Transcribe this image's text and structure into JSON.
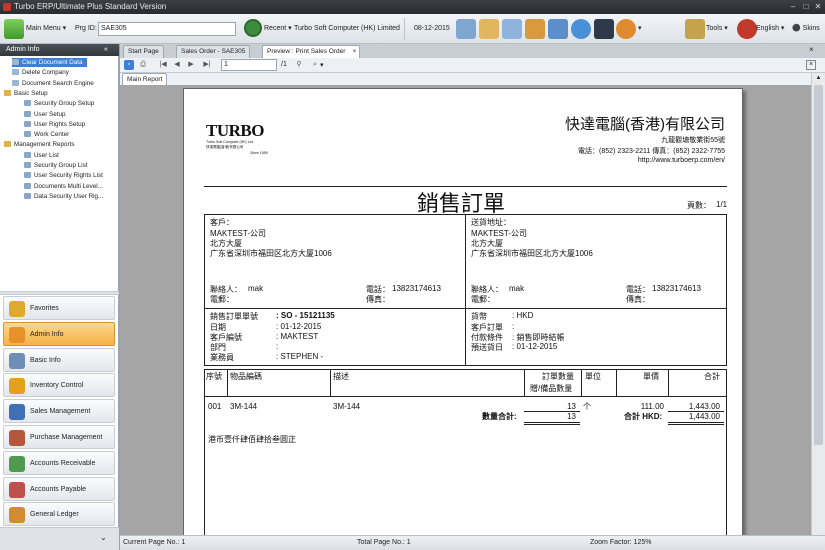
{
  "window": {
    "title": "Turbo ERP/Ultimate Plus Standard Version"
  },
  "toolbar": {
    "main_menu": "Main Menu",
    "prg_id_label": "Prg ID:",
    "prg_id_value": "SAE305",
    "recent": "Recent",
    "company": "Turbo Soft Computer (HK) Limited",
    "date": "08-12-2015",
    "tools": "Tools",
    "language": "English",
    "skins": "Skins"
  },
  "sidebar": {
    "header": "Admin Info",
    "collapse": "«",
    "tree": [
      {
        "label": "Clear Document Data",
        "level": 1,
        "selected": true
      },
      {
        "label": "Delete Company",
        "level": 1
      },
      {
        "label": "Document Search Engine",
        "level": 1
      },
      {
        "label": "Basic Setup",
        "level": 0
      },
      {
        "label": "Security Group Setup",
        "level": 2
      },
      {
        "label": "User Setup",
        "level": 2
      },
      {
        "label": "User Rights Setup",
        "level": 2
      },
      {
        "label": "Work Center",
        "level": 2
      },
      {
        "label": "Management Reports",
        "level": 0
      },
      {
        "label": "User List",
        "level": 2
      },
      {
        "label": "Security Group List",
        "level": 2
      },
      {
        "label": "User Security Rights List",
        "level": 2
      },
      {
        "label": "Documents Multi Level...",
        "level": 2
      },
      {
        "label": "Data Security User Rig...",
        "level": 2
      }
    ],
    "nav": [
      {
        "label": "Favorites",
        "color": "#e0a82e"
      },
      {
        "label": "Admin Info",
        "color": "#e8912a",
        "active": true
      },
      {
        "label": "Basic Info",
        "color": "#6d8fb5"
      },
      {
        "label": "Inventory Control",
        "color": "#e6a020"
      },
      {
        "label": "Sales Management",
        "color": "#3f6fb4"
      },
      {
        "label": "Purchase Management",
        "color": "#b5573c"
      },
      {
        "label": "Accounts Receivable",
        "color": "#4e9a4e"
      },
      {
        "label": "Accounts Payable",
        "color": "#c0504d"
      },
      {
        "label": "General Ledger",
        "color": "#d28b2e"
      }
    ]
  },
  "tabs": [
    "Start Page",
    "Sales Order - SAE305",
    "Preview : Print Sales Order"
  ],
  "viewer": {
    "page_input": "1",
    "page_total": "/1",
    "report_tab": "Main Report"
  },
  "report": {
    "logo_text": "TURBO",
    "logo_sub1": "Turbo Soft Computer (HK) Ltd.",
    "logo_sub2": "快達電腦(香港)有限公司",
    "logo_since": "Since 1989",
    "company_name": "快達電腦(香港)有限公司",
    "address": "九龍觀塘敬業街55號",
    "phone_line": "電話：(852) 2323-2211 傳真：(852) 2322-7755",
    "website": "http://www.turboerp.com/en/",
    "doc_title": "銷售訂單",
    "page_label": "頁數：",
    "page_value": "1/1",
    "customer_label": "客戶：",
    "customer_name": "MAKTEST-公司",
    "customer_addr1": "北方大厦",
    "customer_addr2": "广东省深圳市福田区北方大厦1006",
    "delivery_label": "送貨地址：",
    "delivery_name": "MAKTEST-公司",
    "delivery_addr1": "北方大厦",
    "delivery_addr2": "广东省深圳市福田区北方大厦1006",
    "contact_label": "聯絡人：",
    "contact_value": "mak",
    "tel_label": "電話：",
    "tel_value": "13823174613",
    "email_label": "電郵：",
    "fax_label": "傳真：",
    "so_label": "銷售訂單單號",
    "so_value": "SO - 15121135",
    "date_label": "日期",
    "date_value": "01-12-2015",
    "cust_code_label": "客戶編號",
    "cust_code_value": "MAKTEST",
    "dept_label": "部門",
    "dept_value": "",
    "sales_label": "業務員",
    "sales_value": "STEPHEN -",
    "currency_label": "貨幣",
    "currency_value": "HKD",
    "cust_po_label": "客戶訂單",
    "cust_po_value": "",
    "terms_label": "付款條件",
    "terms_value": "銷售即時結帳",
    "delivery_date_label": "預送貨日",
    "delivery_date_value": "01-12-2015",
    "col_seq": "序號",
    "col_item": "物品編碼",
    "col_desc": "描述",
    "col_qty1": "訂單數量",
    "col_qty2": "贈/備品數量",
    "col_unit": "單位",
    "col_price": "單價",
    "col_total": "合計",
    "rows": [
      {
        "seq": "001",
        "item": "3M-144",
        "desc": "3M-144",
        "qty": "13",
        "unit": "个",
        "price": "111.00",
        "total": "1,443.00"
      }
    ],
    "qty_total_label": "數量合計:",
    "qty_total_value": "13",
    "qty_total_value2": "13",
    "grand_total_label": "合計 HKD:",
    "grand_total_value": "1,443.00",
    "amount_words": "港币壹仟肆佰肆拾叁圆正"
  },
  "status": {
    "current_page": "Current Page No.: 1",
    "total_page": "Total Page No.: 1",
    "zoom": "Zoom Factor: 125%"
  }
}
